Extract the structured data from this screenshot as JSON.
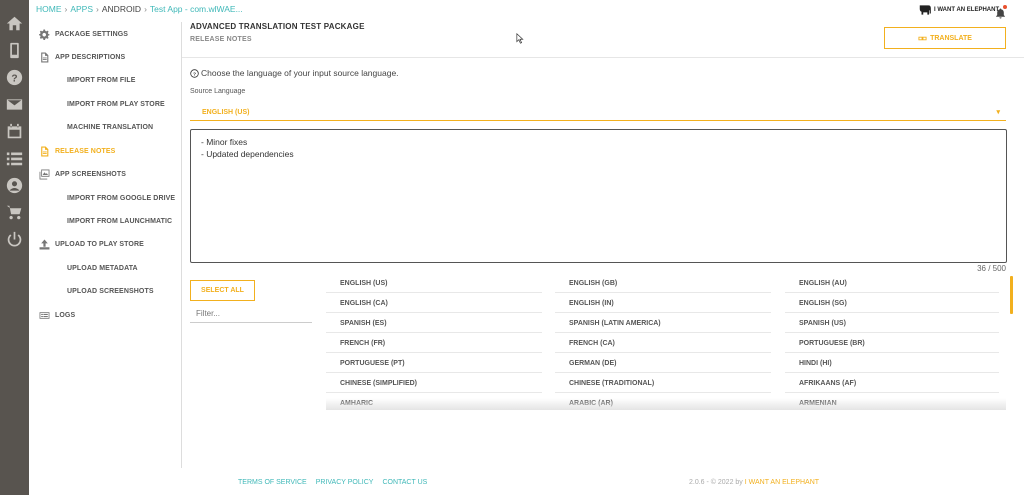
{
  "breadcrumb": {
    "home": "HOME",
    "apps": "APPS",
    "platform": "ANDROID",
    "app": "Test App - com.wlWAE..."
  },
  "sidebar": {
    "items": [
      {
        "label": "PACKAGE SETTINGS",
        "icon": "gear-icon",
        "level": "top"
      },
      {
        "label": "APP DESCRIPTIONS",
        "icon": "document-icon",
        "level": "top"
      },
      {
        "label": "IMPORT FROM FILE",
        "level": "sub"
      },
      {
        "label": "IMPORT FROM PLAY STORE",
        "level": "sub"
      },
      {
        "label": "MACHINE TRANSLATION",
        "level": "sub"
      },
      {
        "label": "RELEASE NOTES",
        "icon": "document-icon",
        "level": "top",
        "active": true
      },
      {
        "label": "APP SCREENSHOTS",
        "icon": "images-icon",
        "level": "top"
      },
      {
        "label": "IMPORT FROM GOOGLE DRIVE",
        "level": "sub"
      },
      {
        "label": "IMPORT FROM LAUNCHMATIC",
        "level": "sub"
      },
      {
        "label": "UPLOAD TO PLAY STORE",
        "icon": "upload-icon",
        "level": "top"
      },
      {
        "label": "UPLOAD METADATA",
        "level": "sub"
      },
      {
        "label": "UPLOAD SCREENSHOTS",
        "level": "sub"
      },
      {
        "label": "LOGS",
        "icon": "logs-icon",
        "level": "top"
      }
    ]
  },
  "header": {
    "title": "ADVANCED TRANSLATION TEST PACKAGE",
    "subtitle": "RELEASE NOTES",
    "translate_label": "TRANSLATE",
    "logo_text": "I WANT AN ELEPHANT"
  },
  "main": {
    "hint": "Choose the language of your input source language.",
    "source_label": "Source Language",
    "source_value": "ENGLISH (US)",
    "notes_text": "- Minor fixes\n- Updated dependencies",
    "counter": "36 / 500",
    "select_all_label": "SELECT ALL",
    "filter_placeholder": "Filter...",
    "languages": [
      "ENGLISH (US)",
      "ENGLISH (GB)",
      "ENGLISH (AU)",
      "ENGLISH (CA)",
      "ENGLISH (IN)",
      "ENGLISH (SG)",
      "SPANISH (ES)",
      "SPANISH (LATIN AMERICA)",
      "SPANISH (US)",
      "FRENCH (FR)",
      "FRENCH (CA)",
      "PORTUGUESE (BR)",
      "PORTUGUESE (PT)",
      "GERMAN (DE)",
      "HINDI (HI)",
      "CHINESE (SIMPLIFIED)",
      "CHINESE (TRADITIONAL)",
      "AFRIKAANS (AF)",
      "AMHARIC",
      "ARABIC (AR)",
      "ARMENIAN"
    ]
  },
  "footer": {
    "terms": "TERMS OF SERVICE",
    "privacy": "PRIVACY POLICY",
    "contact": "CONTACT US",
    "copyright": "2.0.6 - © 2022 by",
    "brand": "I WANT AN ELEPHANT"
  },
  "colors": {
    "accent": "#f2b01e",
    "link": "#3fb8b8",
    "rail": "#58544f"
  }
}
